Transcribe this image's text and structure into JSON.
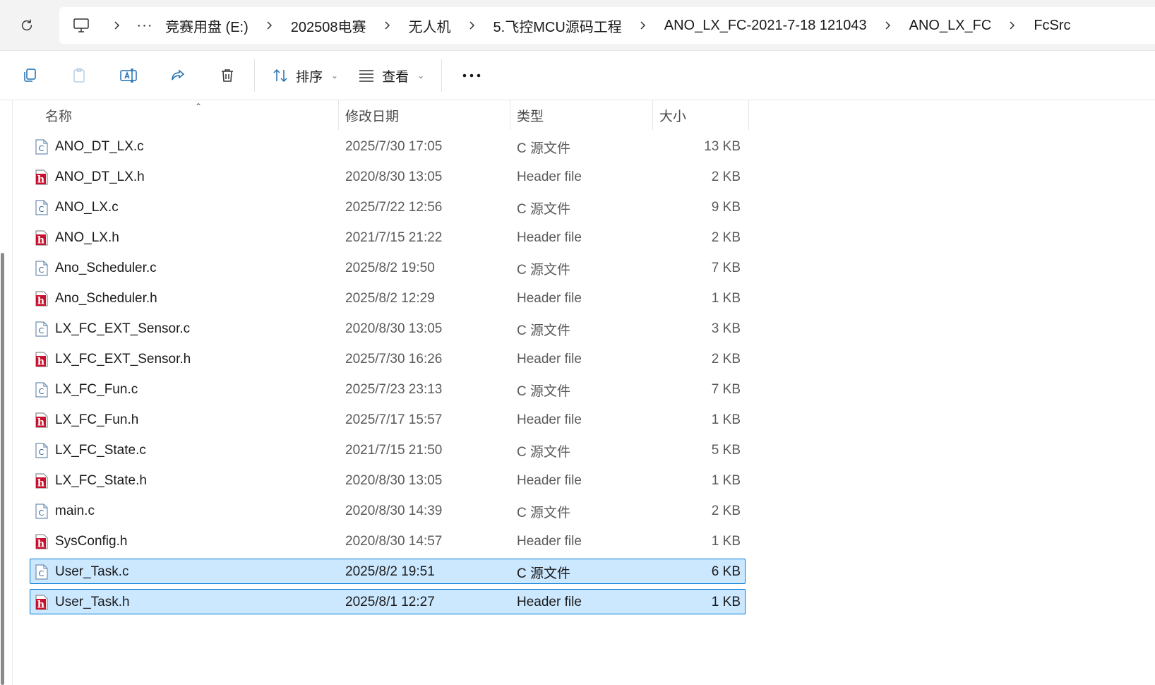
{
  "address_bar": {
    "refresh_icon": "refresh-icon",
    "pc_icon": "this-pc-icon",
    "ellipsis": "···",
    "crumbs": [
      "竞赛用盘 (E:)",
      "202508电赛",
      "无人机",
      "5.飞控MCU源码工程",
      "ANO_LX_FC-2021-7-18 121043",
      "ANO_LX_FC",
      "FcSrc"
    ]
  },
  "command_bar": {
    "icons": [
      "copy-icon",
      "paste-icon",
      "rename-icon",
      "share-icon",
      "delete-icon",
      "more-icon"
    ],
    "sort_label": "排序",
    "view_label": "查看",
    "more_label": "···"
  },
  "columns": {
    "name": "名称",
    "date": "修改日期",
    "type": "类型",
    "size": "大小"
  },
  "files": [
    {
      "name": "ANO_DT_LX.c",
      "date": "2025/7/30 17:05",
      "type": "C 源文件",
      "size": "13 KB",
      "kind": "c",
      "selected": false
    },
    {
      "name": "ANO_DT_LX.h",
      "date": "2020/8/30 13:05",
      "type": "Header file",
      "size": "2 KB",
      "kind": "h",
      "selected": false
    },
    {
      "name": "ANO_LX.c",
      "date": "2025/7/22 12:56",
      "type": "C 源文件",
      "size": "9 KB",
      "kind": "c",
      "selected": false
    },
    {
      "name": "ANO_LX.h",
      "date": "2021/7/15 21:22",
      "type": "Header file",
      "size": "2 KB",
      "kind": "h",
      "selected": false
    },
    {
      "name": "Ano_Scheduler.c",
      "date": "2025/8/2 19:50",
      "type": "C 源文件",
      "size": "7 KB",
      "kind": "c",
      "selected": false
    },
    {
      "name": "Ano_Scheduler.h",
      "date": "2025/8/2 12:29",
      "type": "Header file",
      "size": "1 KB",
      "kind": "h",
      "selected": false
    },
    {
      "name": "LX_FC_EXT_Sensor.c",
      "date": "2020/8/30 13:05",
      "type": "C 源文件",
      "size": "3 KB",
      "kind": "c",
      "selected": false
    },
    {
      "name": "LX_FC_EXT_Sensor.h",
      "date": "2025/7/30 16:26",
      "type": "Header file",
      "size": "2 KB",
      "kind": "h",
      "selected": false
    },
    {
      "name": "LX_FC_Fun.c",
      "date": "2025/7/23 23:13",
      "type": "C 源文件",
      "size": "7 KB",
      "kind": "c",
      "selected": false
    },
    {
      "name": "LX_FC_Fun.h",
      "date": "2025/7/17 15:57",
      "type": "Header file",
      "size": "1 KB",
      "kind": "h",
      "selected": false
    },
    {
      "name": "LX_FC_State.c",
      "date": "2021/7/15 21:50",
      "type": "C 源文件",
      "size": "5 KB",
      "kind": "c",
      "selected": false
    },
    {
      "name": "LX_FC_State.h",
      "date": "2020/8/30 13:05",
      "type": "Header file",
      "size": "1 KB",
      "kind": "h",
      "selected": false
    },
    {
      "name": "main.c",
      "date": "2020/8/30 14:39",
      "type": "C 源文件",
      "size": "2 KB",
      "kind": "c",
      "selected": false
    },
    {
      "name": "SysConfig.h",
      "date": "2020/8/30 14:57",
      "type": "Header file",
      "size": "1 KB",
      "kind": "h",
      "selected": false
    },
    {
      "name": "User_Task.c",
      "date": "2025/8/2 19:51",
      "type": "C 源文件",
      "size": "6 KB",
      "kind": "c",
      "selected": true
    },
    {
      "name": "User_Task.h",
      "date": "2025/8/1 12:27",
      "type": "Header file",
      "size": "1 KB",
      "kind": "h",
      "selected": true
    }
  ],
  "colors": {
    "selection_bg": "#cce8ff",
    "selection_border": "#0078d4",
    "header_icon_red": "#c8102e",
    "accent_blue": "#1f6fb2"
  }
}
